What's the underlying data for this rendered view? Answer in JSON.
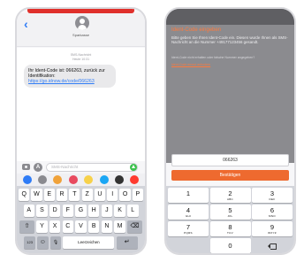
{
  "left_phone": {
    "contact_name": "Sparkasse",
    "meta_line1": "SMS-Nachricht",
    "meta_line2": "Heute 10:31",
    "message_text": "Ihr Ident-Code ist: 066263, zurück zur Identifikation: ",
    "message_link": "https://go.idnow.de/code/066263",
    "input_placeholder": "SMS-Nachricht",
    "app_colors": [
      "#2f7cf6",
      "#8a8a8f",
      "#f0a23a",
      "#e84a5f",
      "#f7d14a",
      "#1aa6f4",
      "#333333",
      "#ff3b30"
    ],
    "keyboard_rows": [
      [
        "Q",
        "W",
        "E",
        "R",
        "T",
        "Z",
        "U",
        "I",
        "O",
        "P"
      ],
      [
        "A",
        "S",
        "D",
        "F",
        "G",
        "H",
        "J",
        "K",
        "L"
      ],
      [
        "Y",
        "X",
        "C",
        "V",
        "B",
        "N",
        "M"
      ]
    ],
    "key_shift": "⇧",
    "key_delete": "⌫",
    "key_numbers": "123",
    "key_emoji": "☺",
    "key_mic": "🎙",
    "key_space": "Leerzeichen",
    "key_return": "↵",
    "back_glyph": "‹",
    "appstore_glyph": "A"
  },
  "right_phone": {
    "title": "Ident-Code eingeben",
    "body": "Bitte geben Sie Ihren Ident-Code ein. Diesen wurde Ihnen als SMS-Nachricht an die Nummer +49177123456 gesandt.",
    "question": "Ident-Code nicht erhalten oder falsche Nummer angegeben?",
    "link": "Ident-Code erneut anfordern",
    "code_value": "066263",
    "confirm_label": "Bestätigen",
    "numpad": [
      {
        "d": "1",
        "l": ""
      },
      {
        "d": "2",
        "l": "ABC"
      },
      {
        "d": "3",
        "l": "DEF"
      },
      {
        "d": "4",
        "l": "GHI"
      },
      {
        "d": "5",
        "l": "JKL"
      },
      {
        "d": "6",
        "l": "MNO"
      },
      {
        "d": "7",
        "l": "PQRS"
      },
      {
        "d": "8",
        "l": "TUV"
      },
      {
        "d": "9",
        "l": "WXYZ"
      }
    ],
    "zero": "0",
    "accent_color": "#ee6a2f"
  }
}
